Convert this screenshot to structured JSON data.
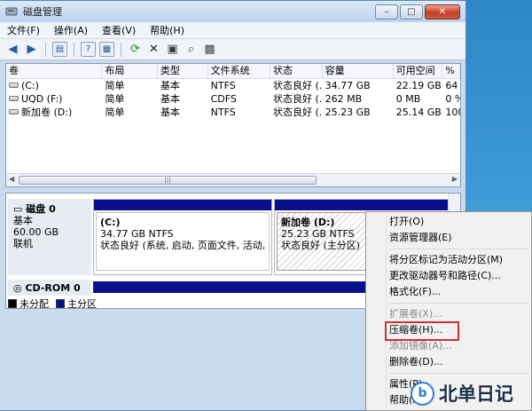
{
  "window": {
    "title": "磁盘管理",
    "controls": {
      "minimize": "–",
      "maximize": "□",
      "close": "✕"
    }
  },
  "menu": [
    "文件(F)",
    "操作(A)",
    "查看(V)",
    "帮助(H)"
  ],
  "toolbar_icons": [
    "back-arrow-icon",
    "forward-arrow-icon",
    "console-tree-icon",
    "help-icon",
    "properties-icon",
    "refresh-icon",
    "delete-icon",
    "open-icon",
    "search-icon",
    "export-icon"
  ],
  "volume_list": {
    "columns": [
      "卷",
      "布局",
      "类型",
      "文件系统",
      "状态",
      "容量",
      "可用空间",
      "%"
    ],
    "rows": [
      {
        "vol": "(C:)",
        "layout": "简单",
        "type": "基本",
        "fs": "NTFS",
        "status": "状态良好 (...",
        "capacity": "34.77 GB",
        "free": "22.19 GB",
        "pct": "64"
      },
      {
        "vol": "UQD (F:)",
        "layout": "简单",
        "type": "基本",
        "fs": "CDFS",
        "status": "状态良好 (...",
        "capacity": "262 MB",
        "free": "0 MB",
        "pct": "0 %"
      },
      {
        "vol": "新加卷 (D:)",
        "layout": "简单",
        "type": "基本",
        "fs": "NTFS",
        "status": "状态良好 (...",
        "capacity": "25.23 GB",
        "free": "25.14 GB",
        "pct": "100"
      }
    ]
  },
  "disk0": {
    "name": "磁盘 0",
    "type": "基本",
    "size": "60.00 GB",
    "state": "联机",
    "partitions": [
      {
        "name": "(C:)",
        "size": "34.77 GB NTFS",
        "status": "状态良好 (系统, 启动, 页面文件, 活动, 故障"
      },
      {
        "name": "新加卷 (D:)",
        "size": "25.23 GB NTFS",
        "status": "状态良好 (主分区)"
      }
    ]
  },
  "cdrom0": {
    "name": "CD-ROM 0"
  },
  "legend": [
    {
      "label": "未分配",
      "color": "#000000"
    },
    {
      "label": "主分区",
      "color": "#0a0f8c"
    }
  ],
  "context_menu": {
    "items": [
      {
        "label": "打开(O)",
        "disabled": false
      },
      {
        "label": "资源管理器(E)",
        "disabled": false
      },
      {
        "sep": true
      },
      {
        "label": "将分区标记为活动分区(M)",
        "disabled": false
      },
      {
        "label": "更改驱动器号和路径(C)...",
        "disabled": false
      },
      {
        "label": "格式化(F)...",
        "disabled": false
      },
      {
        "sep": true
      },
      {
        "label": "扩展卷(X)...",
        "disabled": true
      },
      {
        "label": "压缩卷(H)...",
        "disabled": false,
        "highlighted": true
      },
      {
        "label": "添加镜像(A)...",
        "disabled": true
      },
      {
        "label": "删除卷(D)...",
        "disabled": false
      },
      {
        "sep": true
      },
      {
        "label": "属性(P)",
        "disabled": false
      },
      {
        "label": "帮助(H)",
        "disabled": false
      }
    ]
  },
  "watermark": {
    "text": "北单日记",
    "badge": "b"
  },
  "colors": {
    "primary_partition": "#0a0f8c",
    "highlight_border": "#d32f2f"
  }
}
